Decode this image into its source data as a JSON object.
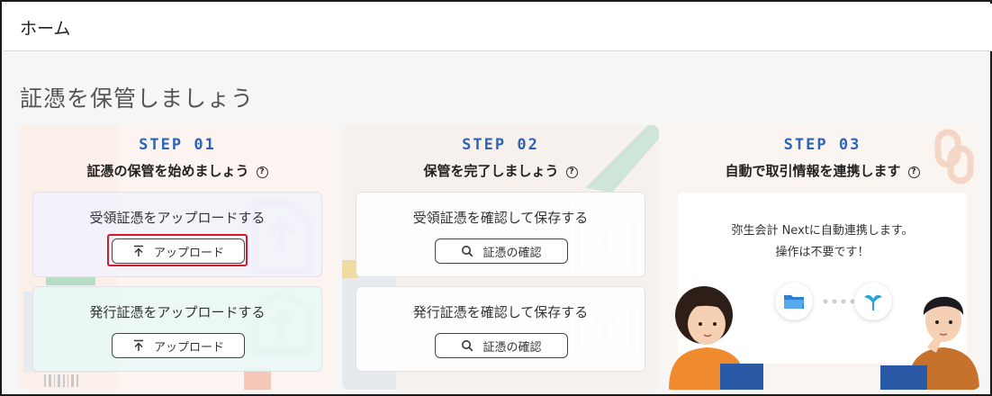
{
  "header": {
    "title": "ホーム"
  },
  "page": {
    "heading": "証憑を保管しましょう"
  },
  "steps": [
    {
      "step_label": "STEP 01",
      "title": "証憑の保管を始めましょう",
      "boxes": [
        {
          "label": "受領証憑をアップロードする",
          "button": "アップロード"
        },
        {
          "label": "発行証憑をアップロードする",
          "button": "アップロード"
        }
      ]
    },
    {
      "step_label": "STEP 02",
      "title": "保管を完了しましょう",
      "boxes": [
        {
          "label": "受領証憑を確認して保存する",
          "button": "証憑の確認"
        },
        {
          "label": "発行証憑を確認して保存する",
          "button": "証憑の確認"
        }
      ]
    },
    {
      "step_label": "STEP 03",
      "title": "自動で取引情報を連携します",
      "message_line1": "弥生会計 Nextに自動連携します。",
      "message_line2": "操作は不要です！"
    }
  ],
  "icons": {
    "help": "?",
    "upload": "upload-arrow-icon",
    "search": "search-icon",
    "folder": "folder-icon",
    "yayoi": "yayoi-logo-icon"
  },
  "colors": {
    "step_blue": "#2f63b8",
    "highlight_red": "#d8192b",
    "box1_bg": "#f2f2fb",
    "box2_bg": "#e9f7f5"
  }
}
